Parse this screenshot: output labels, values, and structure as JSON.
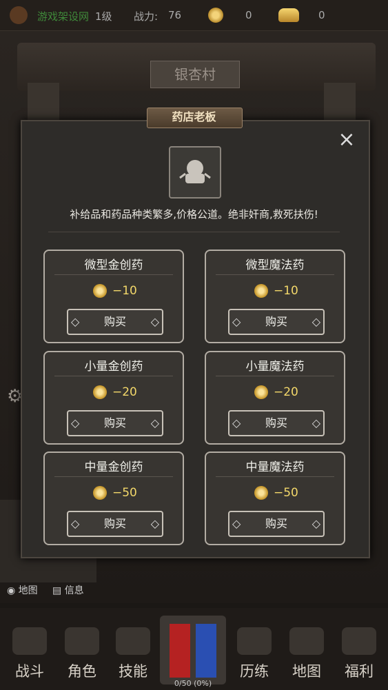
{
  "top": {
    "site": "游戏架设网",
    "level": "1级",
    "power_label": "战力:",
    "power_value": "76",
    "coins": "0",
    "ingots": "0"
  },
  "scene": {
    "village": "银杏村"
  },
  "dialog": {
    "title": "药店老板",
    "description": "补给品和药品种类繁多,价格公道。绝非奸商,救死扶伤!",
    "items": [
      {
        "name": "微型金创药",
        "price": "−10",
        "buy": "购买"
      },
      {
        "name": "微型魔法药",
        "price": "−10",
        "buy": "购买"
      },
      {
        "name": "小量金创药",
        "price": "−20",
        "buy": "购买"
      },
      {
        "name": "小量魔法药",
        "price": "−20",
        "buy": "购买"
      },
      {
        "name": "中量金创药",
        "price": "−50",
        "buy": "购买"
      },
      {
        "name": "中量魔法药",
        "price": "−50",
        "buy": "购买"
      }
    ]
  },
  "side": {
    "map": "地图",
    "info": "信息"
  },
  "nav": [
    {
      "label": "战斗",
      "icon": "swords-icon"
    },
    {
      "label": "角色",
      "icon": "character-icon"
    },
    {
      "label": "技能",
      "icon": "skill-icon"
    },
    {
      "label": "历练",
      "icon": "training-icon"
    },
    {
      "label": "地图",
      "icon": "map-icon"
    },
    {
      "label": "福利",
      "icon": "gift-chest-icon"
    }
  ],
  "hp": "0/50 (0%)"
}
